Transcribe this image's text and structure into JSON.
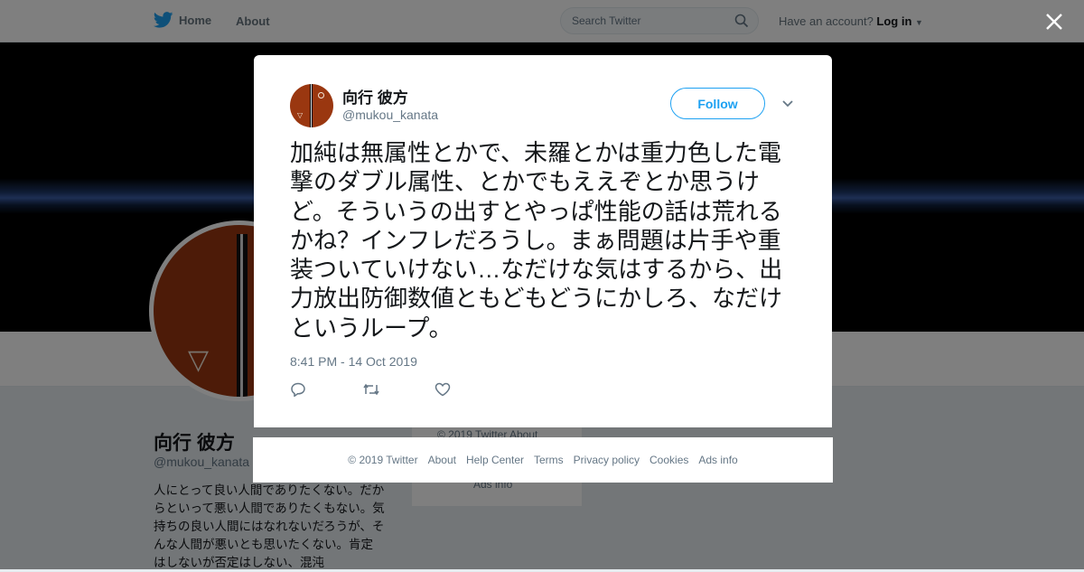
{
  "nav": {
    "home_label": "Home",
    "about_label": "About",
    "search_placeholder": "Search Twitter",
    "have_account": "Have an account?",
    "login_label": "Log in"
  },
  "profile": {
    "name": "向行 彼方",
    "handle": "@mukou_kanata",
    "bio": "人にとって良い人間でありたくない。だからといって悪い人間でありたくもない。気持ちの良い人間にはなれないだろうが、そんな人間が悪いとも思いたくない。肯定はしないが否定はしない、混沌"
  },
  "side_card": {
    "line1": "© 2019 Twitter   About",
    "line2": "Ads info"
  },
  "tweet": {
    "author_name": "向行 彼方",
    "author_handle": "@mukou_kanata",
    "follow_label": "Follow",
    "text": "加純は無属性とかで、未羅とかは重力色した電撃のダブル属性、とかでもええぞとか思うけど。そういうの出すとやっぱ性能の話は荒れるかね？インフレだろうし。まぁ問題は片手や重装ついていけない…なだけな気はするから、出力放出防御数値ともどもどうにかしろ、なだけというループ。",
    "timestamp": "8:41 PM - 14 Oct 2019"
  },
  "footer": {
    "links": [
      "© 2019 Twitter",
      "About",
      "Help Center",
      "Terms",
      "Privacy policy",
      "Cookies",
      "Ads info"
    ]
  },
  "colors": {
    "accent": "#1da1f2",
    "muted": "#657786",
    "overlay": "rgba(0,0,0,0.5)"
  },
  "icons": [
    "twitter-bird-icon",
    "search-icon",
    "caret-down-icon",
    "close-icon",
    "reply-icon",
    "retweet-icon",
    "like-icon",
    "chevron-down-icon"
  ]
}
